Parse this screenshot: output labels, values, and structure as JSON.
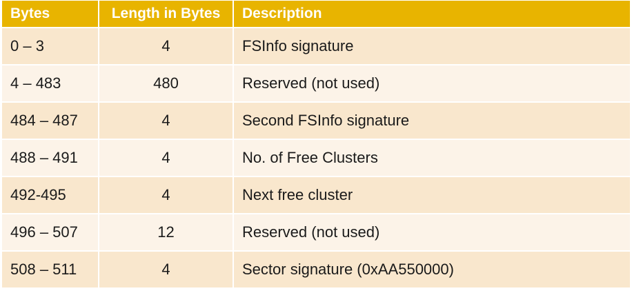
{
  "table": {
    "headers": [
      "Bytes",
      "Length in Bytes",
      "Description"
    ],
    "rows": [
      [
        "0 – 3",
        "4",
        "FSInfo signature"
      ],
      [
        "4 – 483",
        "480",
        "Reserved (not used)"
      ],
      [
        "484 – 487",
        "4",
        "Second FSInfo signature"
      ],
      [
        "488 – 491",
        "4",
        "No. of Free Clusters"
      ],
      [
        "492-495",
        "4",
        "Next free cluster"
      ],
      [
        "496 – 507",
        "12",
        "Reserved (not used)"
      ],
      [
        "508 – 511",
        "4",
        "Sector signature (0xAA550000)"
      ]
    ]
  },
  "colors": {
    "header_bg": "#e8b400",
    "row_odd": "#f9e7cd",
    "row_even": "#fcf3e8"
  }
}
